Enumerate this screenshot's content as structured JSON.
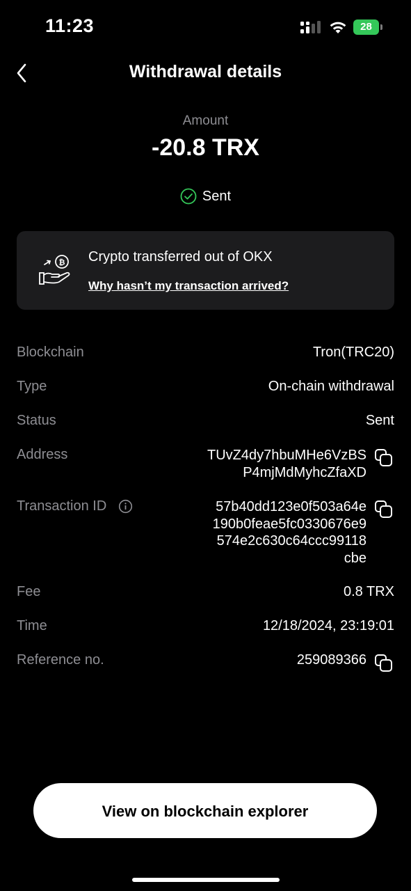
{
  "status_bar": {
    "time": "11:23",
    "battery": "28"
  },
  "header": {
    "title": "Withdrawal details"
  },
  "amount": {
    "label": "Amount",
    "value": "-20.8 TRX",
    "status": "Sent",
    "status_color": "#34c759"
  },
  "notice": {
    "title": "Crypto transferred out of OKX",
    "link": "Why hasn’t my transaction arrived?"
  },
  "details": {
    "blockchain": {
      "label": "Blockchain",
      "value": "Tron(TRC20)"
    },
    "type": {
      "label": "Type",
      "value": "On-chain withdrawal"
    },
    "status": {
      "label": "Status",
      "value": "Sent"
    },
    "address": {
      "label": "Address",
      "line1": "TUvZ4dy7hbuMHe6VzBS",
      "line2": "P4mjMdMyhcZfaXD"
    },
    "transaction_id": {
      "label": "Transaction ID",
      "line1": "57b40dd123e0f503a64e",
      "line2": "190b0feae5fc0330676e9",
      "line3": "574e2c630c64ccc99118",
      "line4": "cbe"
    },
    "fee": {
      "label": "Fee",
      "value": "0.8 TRX"
    },
    "time": {
      "label": "Time",
      "value": "12/18/2024, 23:19:01"
    },
    "reference": {
      "label": "Reference no.",
      "value": "259089366"
    }
  },
  "footer": {
    "explorer_button": "View on blockchain explorer"
  },
  "icons": {
    "back": "chevron-left-icon",
    "copy": "copy-icon",
    "info": "info-icon",
    "check": "check-circle-icon",
    "transfer": "hand-coin-icon"
  }
}
